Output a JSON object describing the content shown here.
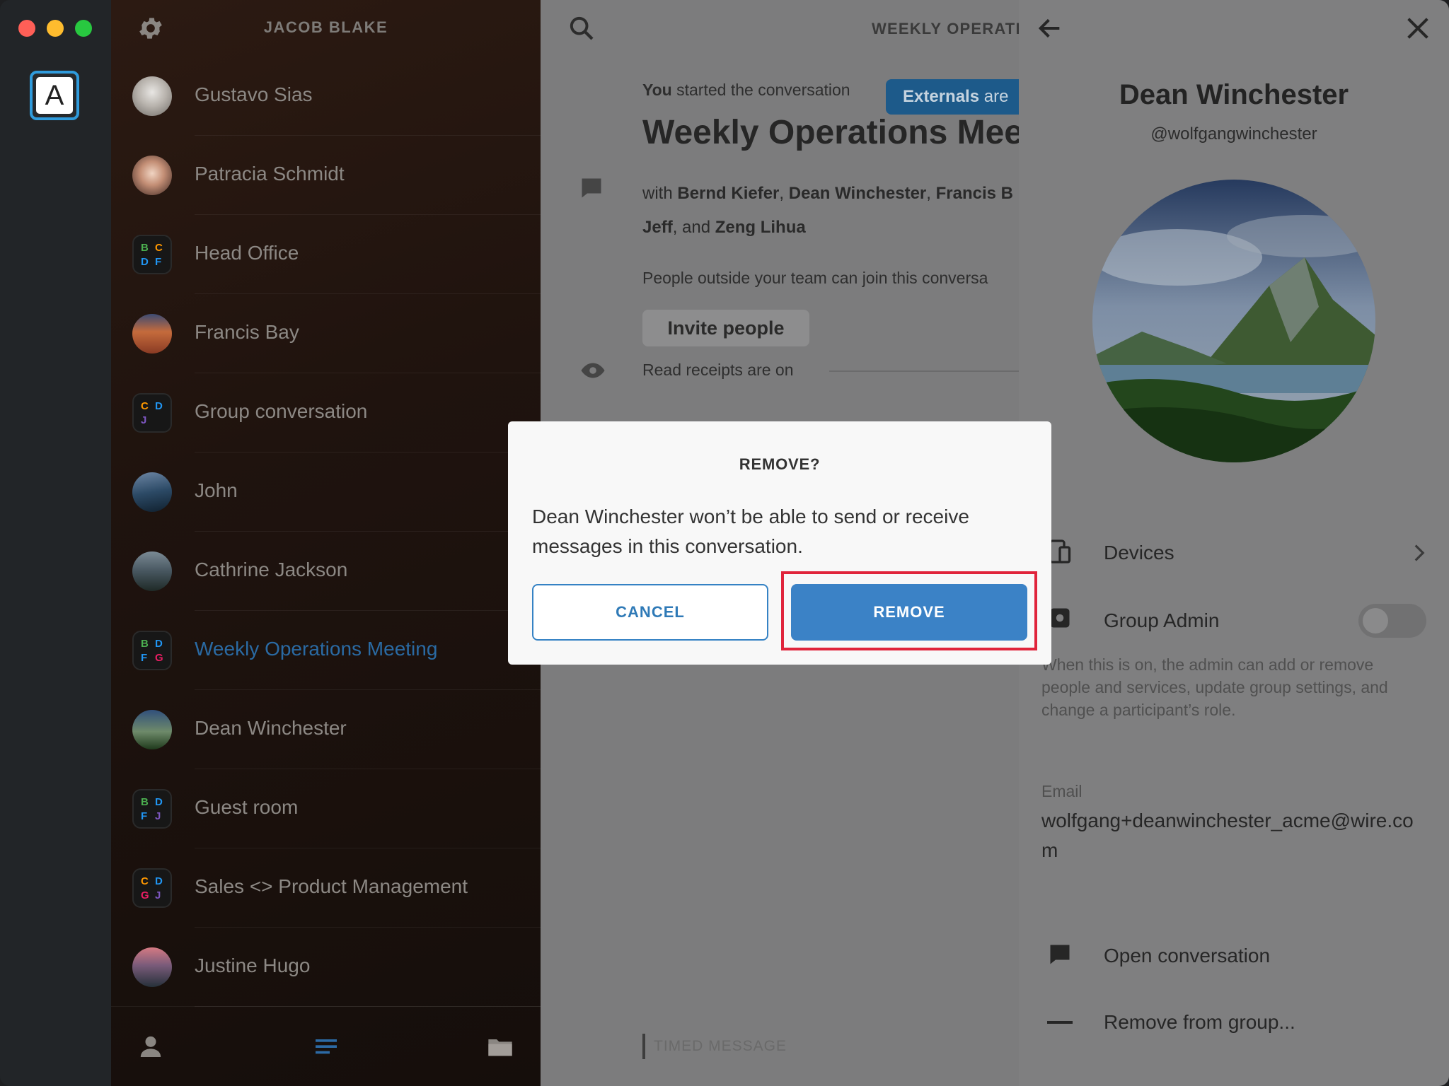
{
  "account": {
    "initial": "A"
  },
  "list": {
    "user_name": "JACOB BLAKE",
    "conversations": [
      {
        "name": "Gustavo Sias",
        "type": "person"
      },
      {
        "name": "Patracia Schmidt",
        "type": "person"
      },
      {
        "name": "Head Office",
        "type": "group",
        "initials": [
          "B",
          "C",
          "D",
          "F"
        ]
      },
      {
        "name": "Francis Bay",
        "type": "person"
      },
      {
        "name": "Group conversation",
        "type": "group",
        "initials": [
          "C",
          "D",
          "J"
        ]
      },
      {
        "name": "John",
        "type": "person"
      },
      {
        "name": "Cathrine Jackson",
        "type": "person"
      },
      {
        "name": "Weekly Operations Meeting",
        "type": "group",
        "initials": [
          "B",
          "D",
          "F",
          "G"
        ],
        "active": true
      },
      {
        "name": "Dean Winchester",
        "type": "person"
      },
      {
        "name": "Guest room",
        "type": "group",
        "initials": [
          "B",
          "D",
          "F",
          "J"
        ]
      },
      {
        "name": "Sales <> Product Management",
        "type": "group",
        "initials": [
          "C",
          "D",
          "G",
          "J"
        ]
      },
      {
        "name": "Justine Hugo",
        "type": "person"
      }
    ]
  },
  "main": {
    "title": "WEEKLY OPERATIO",
    "started_actor": "You",
    "started_text": " started the conversation",
    "externals_strong": "Externals",
    "externals_rest": " are",
    "heading": "Weekly Operations Meet",
    "with_prefix": "with ",
    "participants": [
      "Bernd Kiefer",
      "Dean Winchester",
      "Francis B",
      "Jeff",
      "Zeng Lihua"
    ],
    "and_text": ", and ",
    "external_note": "People outside your team can join this conversa",
    "invite_label": "Invite people",
    "receipts_text": "Read receipts are on",
    "input_placeholder": "TIMED MESSAGE"
  },
  "panel": {
    "name": "Dean Winchester",
    "handle": "@wolfgangwinchester",
    "devices_label": "Devices",
    "group_admin_label": "Group Admin",
    "group_admin_on": false,
    "group_admin_desc": "When this is on, the admin can add or remove people and services, update group settings, and change a participant’s role.",
    "email_label": "Email",
    "email_value": "wolfgang+deanwinchester_acme@wire.com",
    "open_conversation_label": "Open conversation",
    "remove_label": "Remove from group..."
  },
  "modal": {
    "title": "REMOVE?",
    "message": "Dean Winchester won’t be able to send or receive messages in this conversation.",
    "cancel_label": "CANCEL",
    "remove_label": "REMOVE"
  },
  "colors": {
    "accent": "#3b82c6",
    "highlight": "#e0243b",
    "active_conversation": "#2a6aa3",
    "initial_colors": {
      "B": "#4caf50",
      "C": "#ff9800",
      "D": "#2196f3",
      "F": "#2196f3",
      "G": "#e91e63",
      "J": "#7e57c2"
    }
  }
}
